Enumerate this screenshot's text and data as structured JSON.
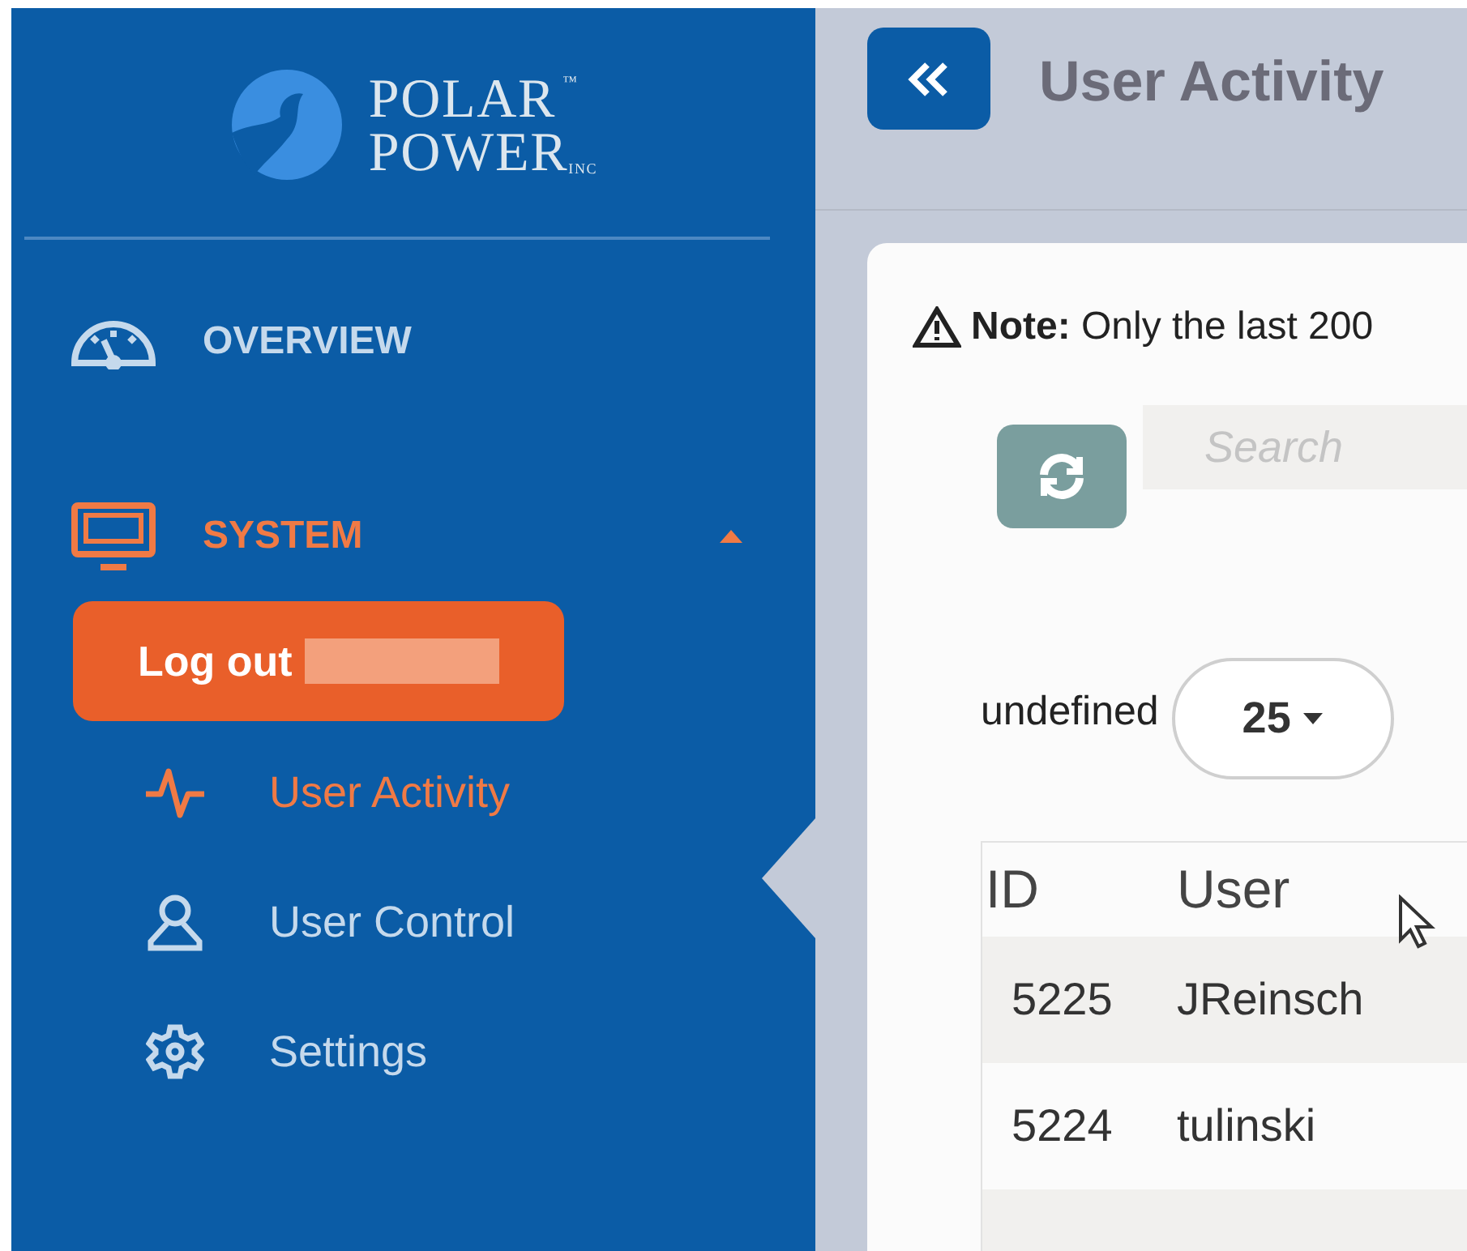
{
  "logo": {
    "line_1": "POLAR",
    "trademark": "™",
    "line_2": "POWER",
    "suffix": "INC"
  },
  "nav": [
    {
      "label": "OVERVIEW",
      "selected": false
    },
    {
      "label": "SYSTEM",
      "selected": true,
      "expanded": true
    }
  ],
  "logout_button": {
    "label": "Log out"
  },
  "subnav": [
    {
      "label": "User Activity",
      "selected": true
    },
    {
      "label": "User Control",
      "selected": false
    },
    {
      "label": "Settings",
      "selected": false
    }
  ],
  "header": {
    "title": "User Activity"
  },
  "note": {
    "text": "**Note:** Only the last 200"
  },
  "search": {
    "placeholder": "Search"
  },
  "page_size": {
    "label": "undefined",
    "value": "25"
  },
  "table": {
    "columns": [
      "ID",
      "User"
    ],
    "rows": [
      [
        "5225",
        "JReinsch"
      ],
      [
        "5224",
        "tulinski"
      ]
    ]
  }
}
